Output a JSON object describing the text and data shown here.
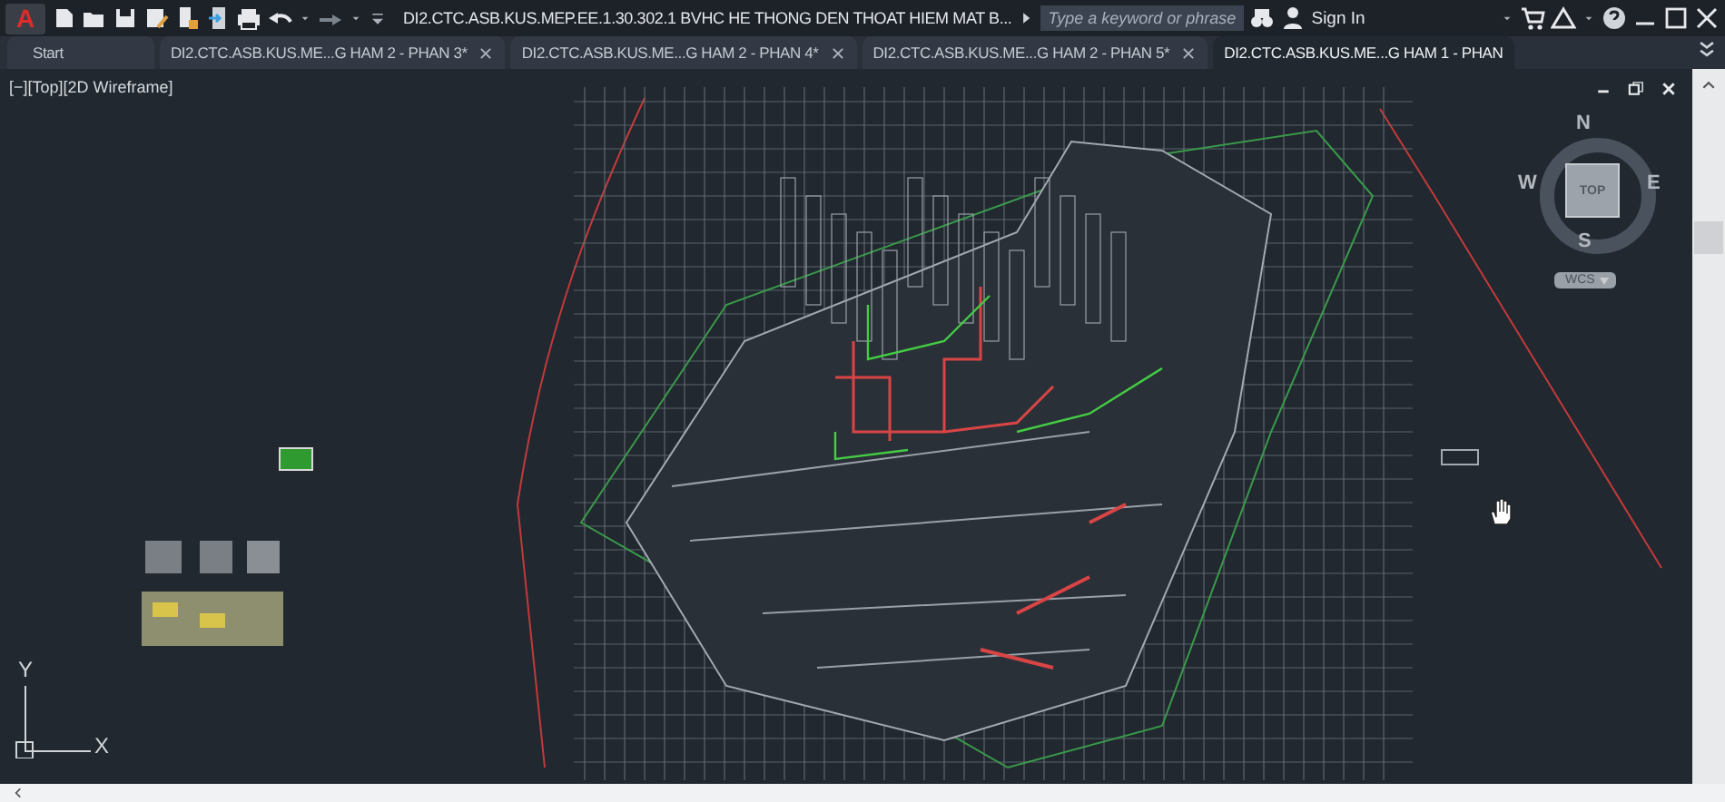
{
  "title_bar": {
    "app_logo": "A",
    "title": "DI2.CTC.ASB.KUS.MEP.EE.1.30.302.1 BVHC HE THONG DEN THOAT HIEM MAT B...",
    "search": {
      "placeholder": "Type a keyword or phrase"
    },
    "sign_in": "Sign In"
  },
  "tabs": [
    {
      "label": "Start",
      "selected": false,
      "closable": false
    },
    {
      "label": "DI2.CTC.ASB.KUS.ME...G HAM 2 - PHAN 3*",
      "selected": false,
      "closable": true
    },
    {
      "label": "DI2.CTC.ASB.KUS.ME...G HAM 2 - PHAN 4*",
      "selected": false,
      "closable": true
    },
    {
      "label": "DI2.CTC.ASB.KUS.ME...G HAM 2 - PHAN 5*",
      "selected": false,
      "closable": true
    },
    {
      "label": "DI2.CTC.ASB.KUS.ME...G HAM 1 - PHAN",
      "selected": true,
      "closable": false
    }
  ],
  "viewport": {
    "label": "[−][Top][2D Wireframe]"
  },
  "viewcube": {
    "north": "N",
    "west": "W",
    "face": "TOP",
    "east": "E",
    "south": "S",
    "ucs": "WCS"
  },
  "ucs_icon": {
    "y": "Y",
    "x": "X"
  }
}
